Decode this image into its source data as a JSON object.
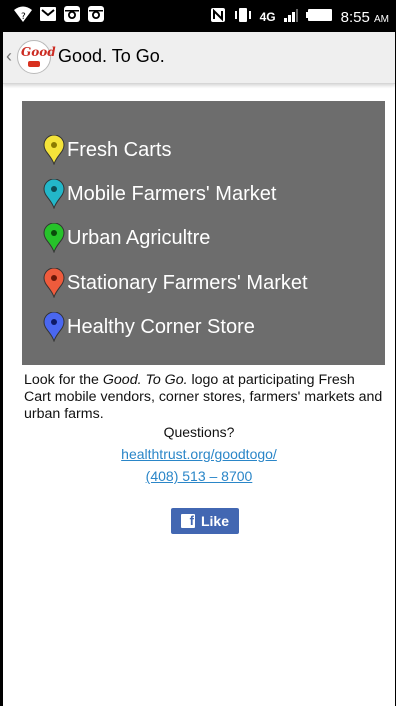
{
  "statusbar": {
    "time": "8:55",
    "ampm": "AM",
    "network": "4G",
    "left_icons": [
      "wifi-question-icon",
      "mail-icon",
      "instagram-icon",
      "instagram-icon"
    ],
    "right_icons": [
      "nfc-icon",
      "vibrate-icon",
      "signal-icon",
      "battery-icon"
    ]
  },
  "appbar": {
    "title": "Good. To Go.",
    "logo_text": "Good",
    "logo_sub": "TO GO"
  },
  "legend": {
    "background": "#6d6d6d",
    "items": [
      {
        "label": "Fresh Carts",
        "color": "#f4e33a",
        "dot": "#8a7a00"
      },
      {
        "label": "Mobile Farmers' Market",
        "color": "#23b7c9",
        "dot": "#0d4c54"
      },
      {
        "label": "Urban Agricultre",
        "color": "#26c22a",
        "dot": "#0a4a0b"
      },
      {
        "label": "Stationary Farmers' Market",
        "color": "#ef5b3c",
        "dot": "#6b1708"
      },
      {
        "label": "Healthy Corner Store",
        "color": "#4a67f0",
        "dot": "#0f1a66"
      }
    ]
  },
  "content": {
    "intro_pre": "Look for the ",
    "intro_em": "Good. To Go.",
    "intro_post": " logo at participating Fresh Cart mobile vendors, corner stores, farmers' markets and urban farms.",
    "questions": "Questions?",
    "site_link": "healthtrust.org/goodtogo/",
    "phone_link": "(408) 513 – 8700",
    "like_label": "Like",
    "link_color": "#2a86c8",
    "facebook_color": "#4267b2"
  }
}
